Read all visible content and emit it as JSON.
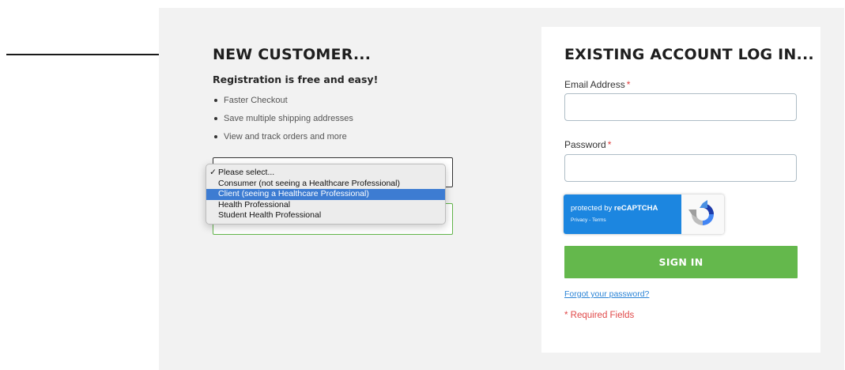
{
  "new_customer": {
    "heading": "NEW CUSTOMER...",
    "subheading": "Registration is free and easy!",
    "benefits": [
      "Faster Checkout",
      "Save multiple shipping addresses",
      "View and track orders and more"
    ],
    "account_type_dropdown": {
      "options": [
        {
          "label": "Please select...",
          "checked": true
        },
        {
          "label": "Consumer (not seeing a Healthcare Professional)"
        },
        {
          "label": "Client (seeing a Healthcare Professional)",
          "highlighted": true
        },
        {
          "label": "Health Professional"
        },
        {
          "label": "Student Health Professional"
        }
      ],
      "check_mark": "✓"
    }
  },
  "login": {
    "heading": "EXISTING ACCOUNT LOG IN...",
    "email_label": "Email Address",
    "password_label": "Password",
    "required_mark": "*",
    "email_value": "",
    "password_value": "",
    "recaptcha": {
      "text_prefix": "protected by ",
      "text_brand": "reCAPTCHA",
      "links": "Privacy - Terms"
    },
    "signin_label": "SIGN IN",
    "forgot_link": "Forgot your password?",
    "required_note": "* Required Fields"
  },
  "colors": {
    "accent_green": "#64b84c",
    "required_red": "#e03a3a",
    "link_blue": "#2b84d6",
    "recaptcha_blue": "#1c86e0",
    "highlight_blue": "#3d7cd2"
  }
}
